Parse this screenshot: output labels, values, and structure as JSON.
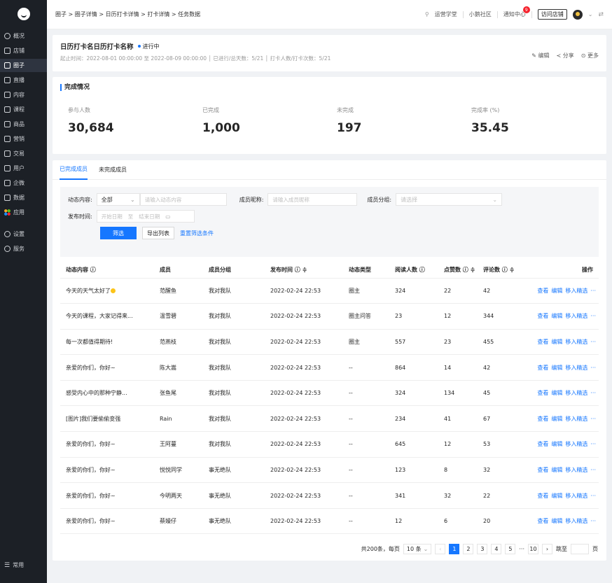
{
  "sidebar": {
    "items": [
      {
        "label": "概况",
        "icon": "dashboard-icon",
        "round": true
      },
      {
        "label": "店铺",
        "icon": "store-icon"
      },
      {
        "label": "圈子",
        "icon": "circle-icon",
        "active": true
      },
      {
        "label": "直播",
        "icon": "live-icon"
      },
      {
        "label": "内容",
        "icon": "content-icon"
      },
      {
        "label": "课程",
        "icon": "course-icon"
      },
      {
        "label": "商品",
        "icon": "goods-icon"
      },
      {
        "label": "营销",
        "icon": "marketing-icon"
      },
      {
        "label": "交易",
        "icon": "trade-icon"
      },
      {
        "label": "用户",
        "icon": "user-icon"
      },
      {
        "label": "企微",
        "icon": "wecom-icon"
      },
      {
        "label": "数据",
        "icon": "data-icon"
      },
      {
        "label": "应用",
        "icon": "apps-icon"
      }
    ],
    "secondary": [
      {
        "label": "设置",
        "icon": "settings-icon"
      },
      {
        "label": "服务",
        "icon": "service-icon"
      }
    ],
    "bottom_label": "常用"
  },
  "topbar": {
    "breadcrumb": "圈子 > 圈子详情 > 日历打卡详情 > 打卡详情 > 任务数据",
    "links": [
      "运营学堂",
      "小鹅社区",
      "通知中心"
    ],
    "notify_count": "9",
    "visit_store": "访问店铺"
  },
  "header": {
    "title": "日历打卡名日历打卡名称",
    "status": "进行中",
    "meta": "起止时间：2022-08-01 00:00:00 至 2022-08-09 00:00:00 │ 已进行/总天数：5/21 │ 打卡人数/打卡次数：5/21",
    "edit": "编辑",
    "share": "分享",
    "more": "更多"
  },
  "completion": {
    "title": "完成情况",
    "stats": [
      {
        "label": "参与人数",
        "value": "30,684"
      },
      {
        "label": "已完成",
        "value": "1,000"
      },
      {
        "label": "未完成",
        "value": "197"
      },
      {
        "label": "完成率 (%)",
        "value": "35.45"
      }
    ]
  },
  "tabs": [
    "已完成成员",
    "未完成成员"
  ],
  "filter": {
    "content_label": "动态内容:",
    "content_select": "全部",
    "content_placeholder": "请输入动态内容",
    "nickname_label": "成员昵称:",
    "nickname_placeholder": "请输入成员昵称",
    "group_label": "成员分组:",
    "group_placeholder": "请选择",
    "time_label": "发布时间:",
    "start_placeholder": "开始日期",
    "to": "至",
    "end_placeholder": "结束日期",
    "filter_btn": "筛选",
    "export_btn": "导出列表",
    "reset_btn": "重置筛选条件"
  },
  "table": {
    "headers": [
      "动态内容 ⓘ",
      "成员",
      "成员分组",
      "发布时间 ⓘ ≑",
      "动态类型",
      "阅读人数 ⓘ",
      "点赞数 ⓘ ≑",
      "评论数 ⓘ ≑",
      "操作"
    ],
    "rows": [
      [
        "今天的天气太好了",
        "范醒鱼",
        "我对我队",
        "2022-02-24 22:53",
        "圈主",
        "324",
        "22",
        "42"
      ],
      [
        "今天的课程，大家记得来...",
        "温雪碧",
        "我对我队",
        "2022-02-24 22:53",
        "圈主问答",
        "23",
        "12",
        "344"
      ],
      [
        "每一次都值得期待!",
        "范燕枝",
        "我对我队",
        "2022-02-24 22:53",
        "圈主",
        "557",
        "23",
        "455"
      ],
      [
        "亲爱的你们，你好~",
        "陈大嵩",
        "我对我队",
        "2022-02-24 22:53",
        "--",
        "864",
        "14",
        "42"
      ],
      [
        "感受内心中的那种宁静...",
        "张鱼尾",
        "我对我队",
        "2022-02-24 22:53",
        "--",
        "324",
        "134",
        "45"
      ],
      [
        "[图片]我们要偷偷变强",
        "Rain",
        "我对我队",
        "2022-02-24 22:53",
        "--",
        "234",
        "41",
        "67"
      ],
      [
        "亲爱的你们，你好~",
        "王阿蔓",
        "我对我队",
        "2022-02-24 22:53",
        "--",
        "645",
        "12",
        "53"
      ],
      [
        "亲爱的你们，你好~",
        "悦悦同学",
        "事无绝队",
        "2022-02-24 22:53",
        "--",
        "123",
        "8",
        "32"
      ],
      [
        "亲爱的你们，你好~",
        "今明两天",
        "事无绝队",
        "2022-02-24 22:53",
        "--",
        "341",
        "32",
        "22"
      ],
      [
        "亲爱的你们，你好~",
        "蔡嫚仔",
        "事无绝队",
        "2022-02-24 22:53",
        "--",
        "12",
        "6",
        "20"
      ]
    ],
    "ops": [
      "查看",
      "编辑",
      "移入精选",
      "···"
    ]
  },
  "pagination": {
    "total": "共200条，每页",
    "page_size": "10 条",
    "pages": [
      "1",
      "2",
      "3",
      "4",
      "5"
    ],
    "ellipsis": "···",
    "last": "10",
    "jump": "跳至",
    "page_unit": "页"
  }
}
